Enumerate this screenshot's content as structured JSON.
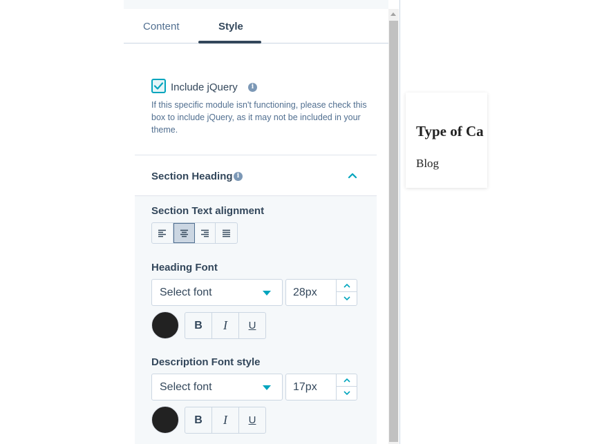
{
  "tabs": [
    {
      "label": "Content",
      "active": false
    },
    {
      "label": "Style",
      "active": true
    }
  ],
  "jquery": {
    "checked": true,
    "label": "Include jQuery",
    "help": "If this specific module isn't functioning, please check this box to include jQuery, as it may not be included in your theme."
  },
  "section_heading": {
    "title": "Section Heading",
    "expanded": true
  },
  "alignment": {
    "label": "Section Text alignment",
    "options": [
      "left",
      "center",
      "right",
      "justify"
    ],
    "selected": "center"
  },
  "heading_font": {
    "label": "Heading Font",
    "select_value": "Select font",
    "size": "28px",
    "color": "#222222",
    "style_buttons": [
      "B",
      "I",
      "U"
    ]
  },
  "description_font": {
    "label": "Description Font style",
    "select_value": "Select font",
    "size": "17px",
    "color": "#222222",
    "style_buttons": [
      "B",
      "I",
      "U"
    ]
  },
  "preview": {
    "title": "Type of Ca",
    "description": "Blog"
  },
  "colors": {
    "accent": "#00a4bd",
    "text": "#33475b",
    "muted": "#516f90",
    "border": "#cbd6e2",
    "panel_bg": "#f5f8fa"
  }
}
